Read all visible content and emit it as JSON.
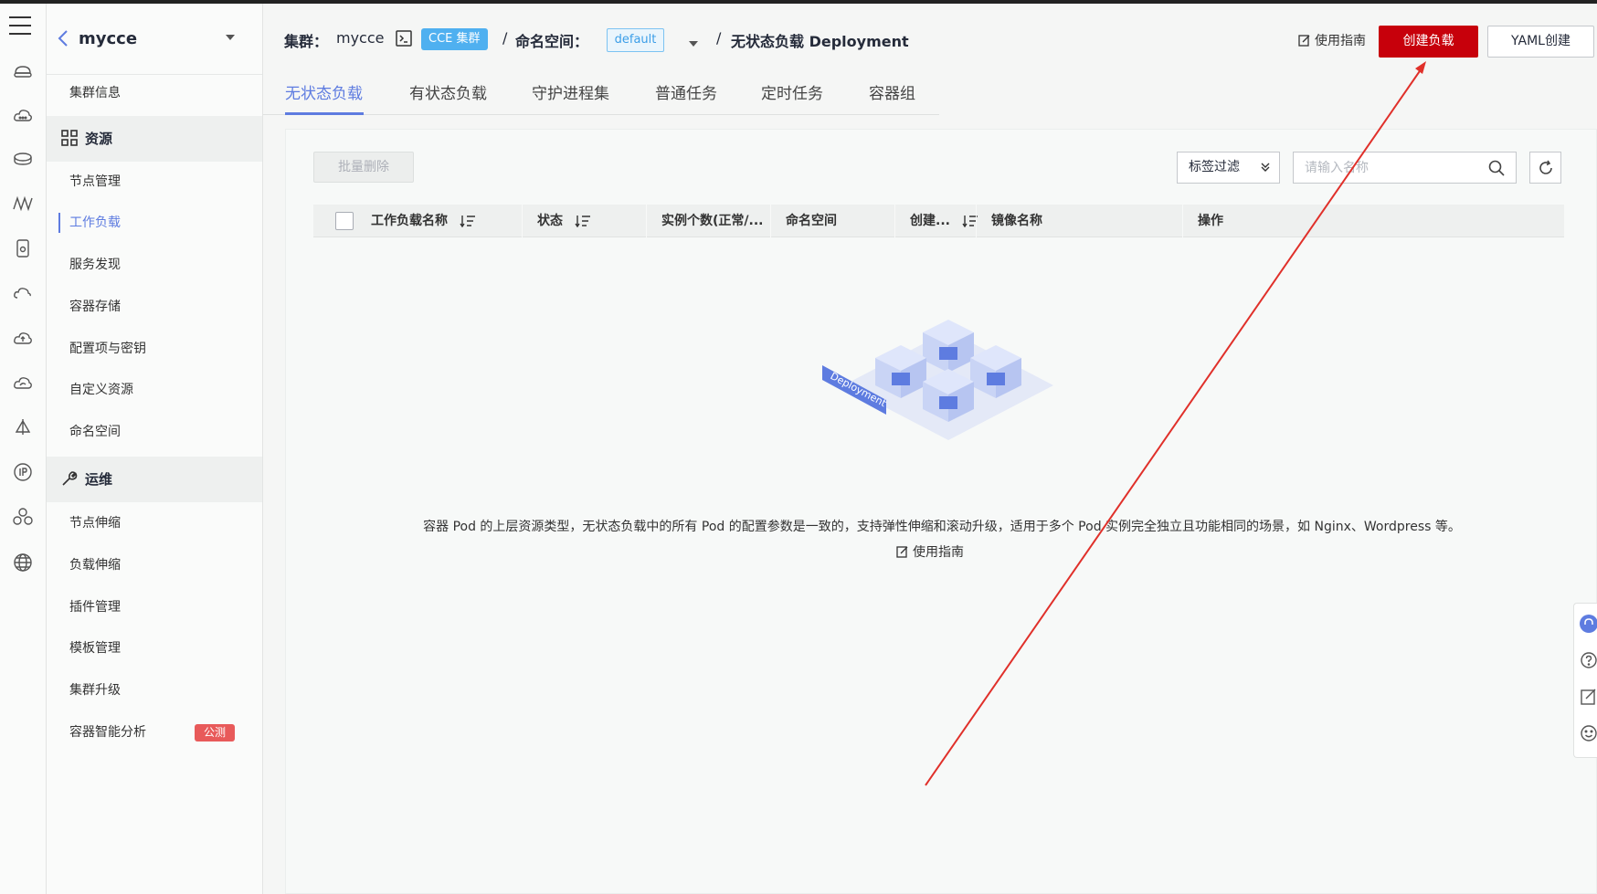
{
  "sidebar": {
    "cluster_name": "mycce",
    "items": [
      {
        "label": "集群信息"
      },
      {
        "label": "资源"
      },
      {
        "label": "节点管理"
      },
      {
        "label": "工作负载"
      },
      {
        "label": "服务发现"
      },
      {
        "label": "容器存储"
      },
      {
        "label": "配置项与密钥"
      },
      {
        "label": "自定义资源"
      },
      {
        "label": "命名空间"
      },
      {
        "label": "运维"
      },
      {
        "label": "节点伸缩"
      },
      {
        "label": "负载伸缩"
      },
      {
        "label": "插件管理"
      },
      {
        "label": "模板管理"
      },
      {
        "label": "集群升级"
      },
      {
        "label": "容器智能分析"
      }
    ],
    "beta_badge": "公测"
  },
  "header": {
    "cluster_label": "集群：",
    "cluster_value": "mycce",
    "cluster_tag": "CCE 集群",
    "sep": "/",
    "namespace_label": "命名空间：",
    "namespace_value": "default",
    "page_title": "无状态负载 Deployment",
    "guide": "使用指南",
    "create_button": "创建负载",
    "yaml_button": "YAML创建"
  },
  "tabs": [
    {
      "label": "无状态负载"
    },
    {
      "label": "有状态负载"
    },
    {
      "label": "守护进程集"
    },
    {
      "label": "普通任务"
    },
    {
      "label": "定时任务"
    },
    {
      "label": "容器组"
    }
  ],
  "toolbar": {
    "bulk_delete": "批量删除",
    "label_filter": "标签过滤",
    "search_placeholder": "请输入名称"
  },
  "table": {
    "columns": [
      "工作负载名称",
      "状态",
      "实例个数(正常/...",
      "命名空间",
      "创建...",
      "镜像名称",
      "操作"
    ]
  },
  "empty_state": {
    "illustration_label": "Deployment",
    "description": "容器 Pod 的上层资源类型，无状态负载中的所有 Pod 的配置参数是一致的，支持弹性伸缩和滚动升级，适用于多个 Pod 实例完全独立且功能相同的场景，如 Nginx、Wordpress 等。",
    "guide": "使用指南"
  },
  "colors": {
    "accent": "#5e7ce0",
    "create_button": "#c7000b",
    "tag_blue": "#4fb0f0",
    "beta_badge": "#e85a5a",
    "annotation_arrow": "#e0302a"
  },
  "icons": {
    "rail": [
      "menu-icon",
      "cloud-server-icon",
      "cloud-icon",
      "database-icon",
      "network-icon",
      "storage-icon",
      "cloud-outline-icon",
      "cloud-upload-icon",
      "cloud-sync-icon",
      "deploy-icon",
      "ip-icon",
      "cluster-icon",
      "globe-icon"
    ],
    "float": [
      "customer-service-icon",
      "help-icon",
      "edit-icon",
      "smile-icon"
    ]
  }
}
